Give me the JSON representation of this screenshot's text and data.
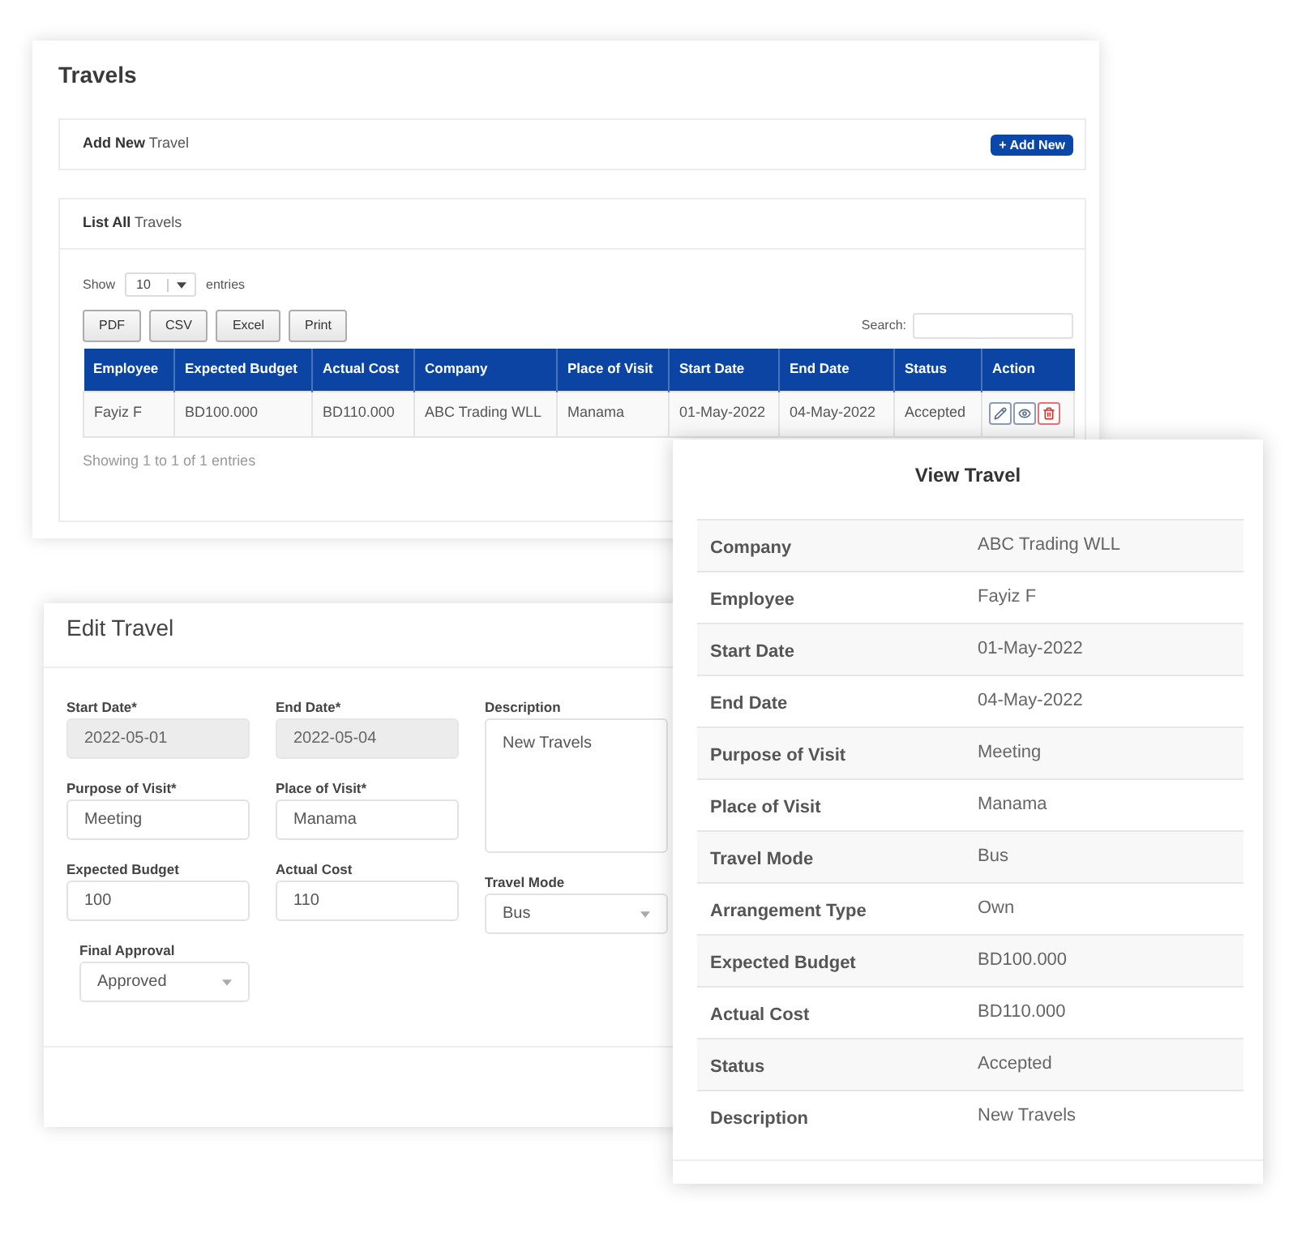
{
  "travels": {
    "title": "Travels",
    "add_section": {
      "title": "**Add New** Travel",
      "button": "+ Add New"
    },
    "list_section": {
      "title": "**List All** Travels",
      "show": {
        "label": "Show",
        "value": "10",
        "suffix": "entries"
      },
      "export_buttons": [
        "PDF",
        "CSV",
        "Excel",
        "Print"
      ],
      "search": {
        "label": "Search:"
      },
      "table": {
        "columns": [
          "Employee",
          "Expected Budget",
          "Actual Cost",
          "Company",
          "Place of Visit",
          "Start Date",
          "End Date",
          "Status",
          "Action"
        ],
        "rows": [
          {
            "cells": [
              "Fayiz F",
              "BD100.000",
              "BD110.000",
              "ABC Trading WLL",
              "Manama",
              "01-May-2022",
              "04-May-2022",
              "Accepted"
            ],
            "actions": [
              {
                "kind": "edit"
              },
              {
                "kind": "view"
              },
              {
                "kind": "delete"
              }
            ]
          }
        ]
      },
      "info": "Showing 1 to 1 of 1 entries"
    }
  },
  "edit_travel": {
    "title": "Edit Travel",
    "columns": [
      [
        {
          "label": "Start Date*",
          "value": "2022-05-01",
          "kind": "input",
          "disabled": true
        },
        {
          "label": "Purpose of Visit*",
          "value": "Meeting",
          "kind": "input",
          "disabled": false
        },
        {
          "label": "Expected Budget",
          "value": "100",
          "kind": "input",
          "disabled": false
        },
        {
          "label": "Final Approval",
          "value": "Approved",
          "kind": "select",
          "disabled": false
        }
      ],
      [
        {
          "label": "End Date*",
          "value": "2022-05-04",
          "kind": "input",
          "disabled": true
        },
        {
          "label": "Place of Visit*",
          "value": "Manama",
          "kind": "input",
          "disabled": false
        },
        {
          "label": "Actual Cost",
          "value": "110",
          "kind": "input",
          "disabled": false
        }
      ],
      [
        {
          "label": "Description",
          "value": "New Travels",
          "kind": "textarea",
          "disabled": false
        },
        {
          "label": "Travel Mode",
          "value": "Bus",
          "kind": "select",
          "disabled": false
        }
      ]
    ]
  },
  "view_travel": {
    "title": "View Travel",
    "rows": [
      {
        "label": "Company",
        "value": "ABC Trading WLL"
      },
      {
        "label": "Employee",
        "value": "Fayiz F"
      },
      {
        "label": "Start Date",
        "value": "01-May-2022"
      },
      {
        "label": "End Date",
        "value": "04-May-2022"
      },
      {
        "label": "Purpose of Visit",
        "value": "Meeting"
      },
      {
        "label": "Place of Visit",
        "value": "Manama"
      },
      {
        "label": "Travel Mode",
        "value": "Bus"
      },
      {
        "label": "Arrangement Type",
        "value": "Own"
      },
      {
        "label": "Expected Budget",
        "value": "BD100.000"
      },
      {
        "label": "Actual Cost",
        "value": "BD110.000"
      },
      {
        "label": "Status",
        "value": "Accepted"
      },
      {
        "label": "Description",
        "value": "New Travels"
      }
    ]
  }
}
